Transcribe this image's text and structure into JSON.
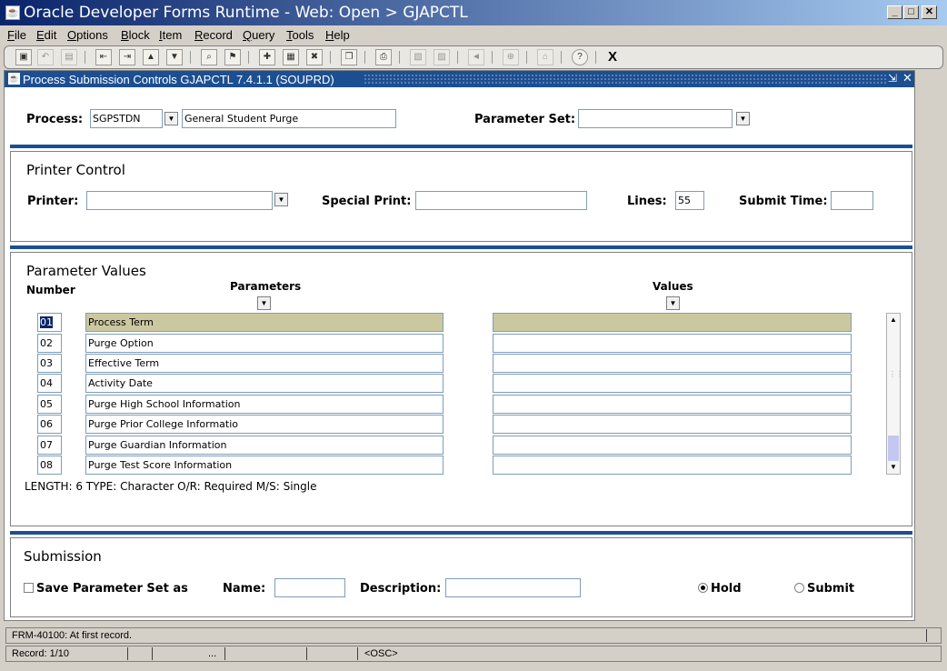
{
  "window": {
    "title": "Oracle Developer Forms Runtime - Web:  Open > GJAPCTL"
  },
  "menu": [
    {
      "u": "F",
      "rest": "ile"
    },
    {
      "u": "E",
      "rest": "dit"
    },
    {
      "u": "O",
      "rest": "ptions"
    },
    {
      "u": "B",
      "rest": "lock"
    },
    {
      "u": "I",
      "rest": "tem"
    },
    {
      "u": "R",
      "rest": "ecord"
    },
    {
      "u": "Q",
      "rest": "uery"
    },
    {
      "u": "T",
      "rest": "ools"
    },
    {
      "u": "H",
      "rest": "elp"
    }
  ],
  "toolbar": {
    "icons": [
      "save-icon",
      "rollback-icon",
      "print-icon",
      "prev-block-icon",
      "next-block-icon",
      "prev-record-icon",
      "next-record-icon",
      "enter-query-icon",
      "execute-query-icon",
      "insert-record-icon",
      "delete-record-icon",
      "remove-record-icon",
      "print-screen-icon",
      "copy-icon",
      "paste-icon",
      "speaker-icon",
      "target-icon",
      "export-icon",
      "help-icon",
      "exit-icon"
    ],
    "exit_label": "X"
  },
  "form": {
    "title": "Process Submission Controls  GJAPCTL  7.4.1.1  (SOUPRD)",
    "process_label": "Process:",
    "process_code": "SGPSTDN",
    "process_desc": "General Student Purge",
    "paramset_label": "Parameter Set:",
    "paramset_value": "",
    "printer_section": "Printer Control",
    "printer_label": "Printer:",
    "printer_value": "",
    "special_print_label": "Special Print:",
    "special_print_value": "",
    "lines_label": "Lines:",
    "lines_value": "55",
    "submit_time_label": "Submit Time:",
    "submit_time_value": "",
    "param_section": "Parameter Values",
    "number_header": "Number",
    "parameters_header": "Parameters",
    "values_header": "Values",
    "rows": [
      {
        "num": "01",
        "param": "Process Term",
        "value": ""
      },
      {
        "num": "02",
        "param": "Purge Option",
        "value": ""
      },
      {
        "num": "03",
        "param": "Effective Term",
        "value": ""
      },
      {
        "num": "04",
        "param": "Activity Date",
        "value": ""
      },
      {
        "num": "05",
        "param": "Purge High School Information",
        "value": ""
      },
      {
        "num": "06",
        "param": "Purge Prior College Informatio",
        "value": ""
      },
      {
        "num": "07",
        "param": "Purge Guardian Information",
        "value": ""
      },
      {
        "num": "08",
        "param": "Purge Test Score Information",
        "value": ""
      }
    ],
    "hint": "LENGTH: 6 TYPE: Character O/R: Required M/S: Single",
    "submission_section": "Submission",
    "save_paramset_label": "Save Parameter Set as",
    "name_label": "Name:",
    "name_value": "",
    "description_label": "Description:",
    "description_value": "",
    "hold_label": "Hold",
    "submit_label": "Submit",
    "selected_option": "Hold"
  },
  "status": {
    "message": "FRM-40100: At first record.",
    "record": "Record: 1/10",
    "ellipsis": "...",
    "mode": "<OSC>"
  }
}
